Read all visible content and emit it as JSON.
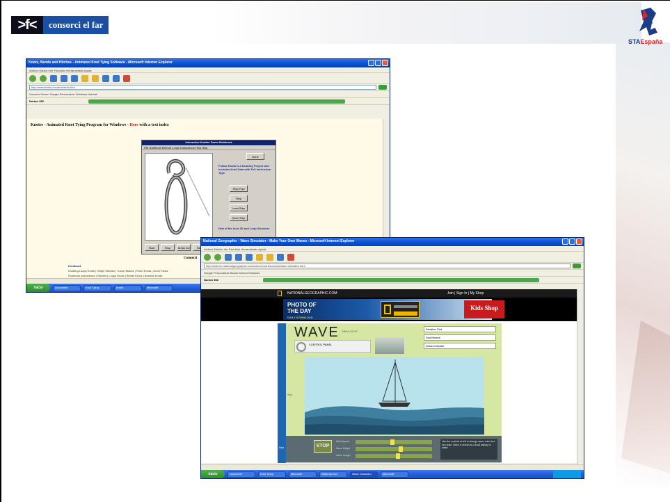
{
  "slide": {
    "logo_mark": ">f<",
    "logo_text": "consorci el far",
    "sta_logo": {
      "text_a": "STA",
      "text_b": "España"
    }
  },
  "window1": {
    "title": "Knots, Bends and Hitches - Animated Knot Tying Software - Microsoft Internet Explorer",
    "menu": "Archivo   Edición   Ver   Favoritos   Herramientas   Ayuda",
    "address": "http://www.knots.com/knotsinfo.htm",
    "links": "Vínculos   Norton   Google   Personalizar   Windows   Hotmail",
    "norton": "Norton 360",
    "heading_main": "Knotes - Animated Knot Tying Program for Windows - ",
    "heading_red": "Here",
    "heading_tail": " with a text index",
    "dialog": {
      "title": "Interactive Knotter Demo Notebook",
      "menu": "File   Notebook   Method Loops Instructions   Help   Help",
      "instructions": "Follow Knots is a Drawing Project and Includes Knot Data with Full Instruction Type",
      "buttons": [
        "Done",
        "Step Fwd",
        "Step",
        "Load Step",
        "Save Step"
      ],
      "footer_note": "Part of the knot 3D and Loop Structure",
      "bottom_buttons": [
        "Start",
        "Stop",
        "Break Ind",
        "Next"
      ]
    },
    "connect_label": "Connecti",
    "bottom_links_title": "Knotbook",
    "bottom_links": [
      "Knotting Loops Knots | Single Hitches | Turns Hitches | Fixed Knots | Gone Knots",
      "Knotbook Instructions | Hitches | Loops Knots | Bends Knots | Bowline Knots"
    ],
    "taskbar": {
      "start": "inicio",
      "tasks": [
        "Document",
        "Knot Tying",
        "Knots",
        "Microsoft"
      ]
    }
  },
  "window2": {
    "title": "National Geographic - Wave Simulator - Make Your Own Waves - Microsoft Internet Explorer",
    "menu": "Archivo   Edición   Ver   Favoritos   Herramientas   Ayuda",
    "address": "http://science.nationalgeographic.com/science/earth/oceans/wave-simulator.html",
    "links": "Google   Personalizar   Buscar   Norton   Windows",
    "norton": "Norton 360",
    "ng_top": "NATIONALGEOGRAPHIC.COM",
    "ng_top_right": "Join  |  Sign In  |  My Shop",
    "potd_line1": "PHOTO OF",
    "potd_line2": "THE DAY",
    "potd_small": "DAILY DOWNLOAD",
    "kids_shop": "Kids Shop",
    "wave": {
      "logo": "WAVE",
      "sub": "SIMULATOR",
      "ctrl_text": "CONTROL PANEL",
      "selects": [
        "Weather Flat",
        "Sea Breeze",
        "Wave Indicator"
      ],
      "sky_label": "Sky",
      "panel_label": "Sea",
      "stop": "STOP",
      "sliders": [
        "Wind Speed",
        "Wave Height",
        "Wave Length"
      ],
      "info": "Use the controls at left to change wave, wind and sea state. Wave is shown as a boat sailing on water."
    },
    "taskbar": {
      "start": "inicio",
      "tasks": [
        "Document",
        "Knot Tying",
        "Microsoft",
        "National Geo",
        "Wave Simulator",
        "Microsoft"
      ]
    }
  }
}
